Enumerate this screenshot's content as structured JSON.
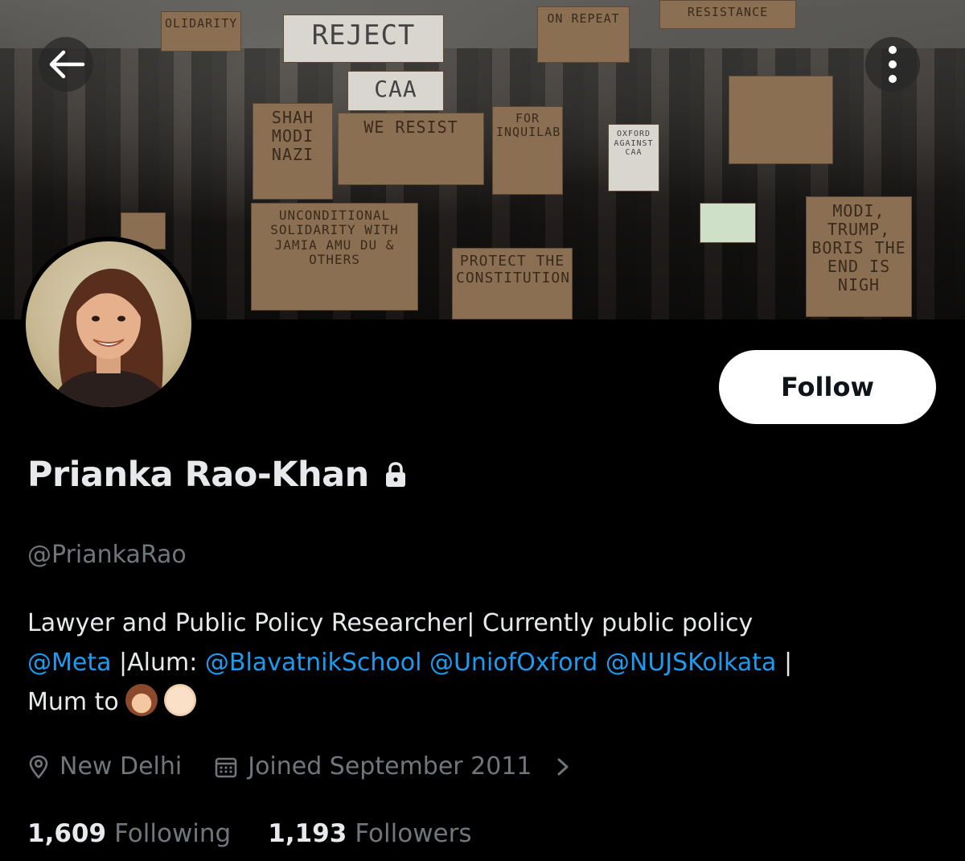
{
  "banner": {
    "signs": [
      "OLIDARITY",
      "REJECT",
      "ON REPEAT",
      "RESISTANCE",
      "CAA",
      "SHAH MODI NAZI",
      "WE RESIST",
      "FOR INQUILAB",
      "OXFORD AGAINST CAA",
      "UNCONDITIONAL SOLIDARITY WITH JAMIA AMU DU & OTHERS",
      "PROTECT THE CONSTITUTION",
      "MODI, TRUMP, BORIS THE END IS NIGH"
    ]
  },
  "profile": {
    "name": "Prianka Rao-Khan",
    "handle": "@PriankaRao",
    "follow_label": "Follow",
    "bio": {
      "line1": "Lawyer and Public Policy Researcher| Currently public policy",
      "mention_meta": "@Meta",
      "alum_text": " |Alum: ",
      "mention_blavatnik": "@BlavatnikSchool",
      "mention_oxford": "@UniofOxford",
      "mention_nujs": "@NUJSKolkata",
      "sep": " |",
      "mum_text": "Mum to"
    },
    "location": "New Delhi",
    "joined": "Joined September 2011",
    "following_count": "1,609",
    "following_label": "Following",
    "followers_count": "1,193",
    "followers_label": "Followers"
  },
  "icons": {
    "back": "back-arrow-icon",
    "more": "more-vertical-icon",
    "lock": "lock-icon",
    "location": "location-pin-icon",
    "calendar": "calendar-icon",
    "chevron": "chevron-right-icon"
  },
  "colors": {
    "background": "#000000",
    "text": "#e7e9ea",
    "muted": "#71767b",
    "link": "#1d9bf0",
    "follow_button_bg": "#ffffff"
  }
}
